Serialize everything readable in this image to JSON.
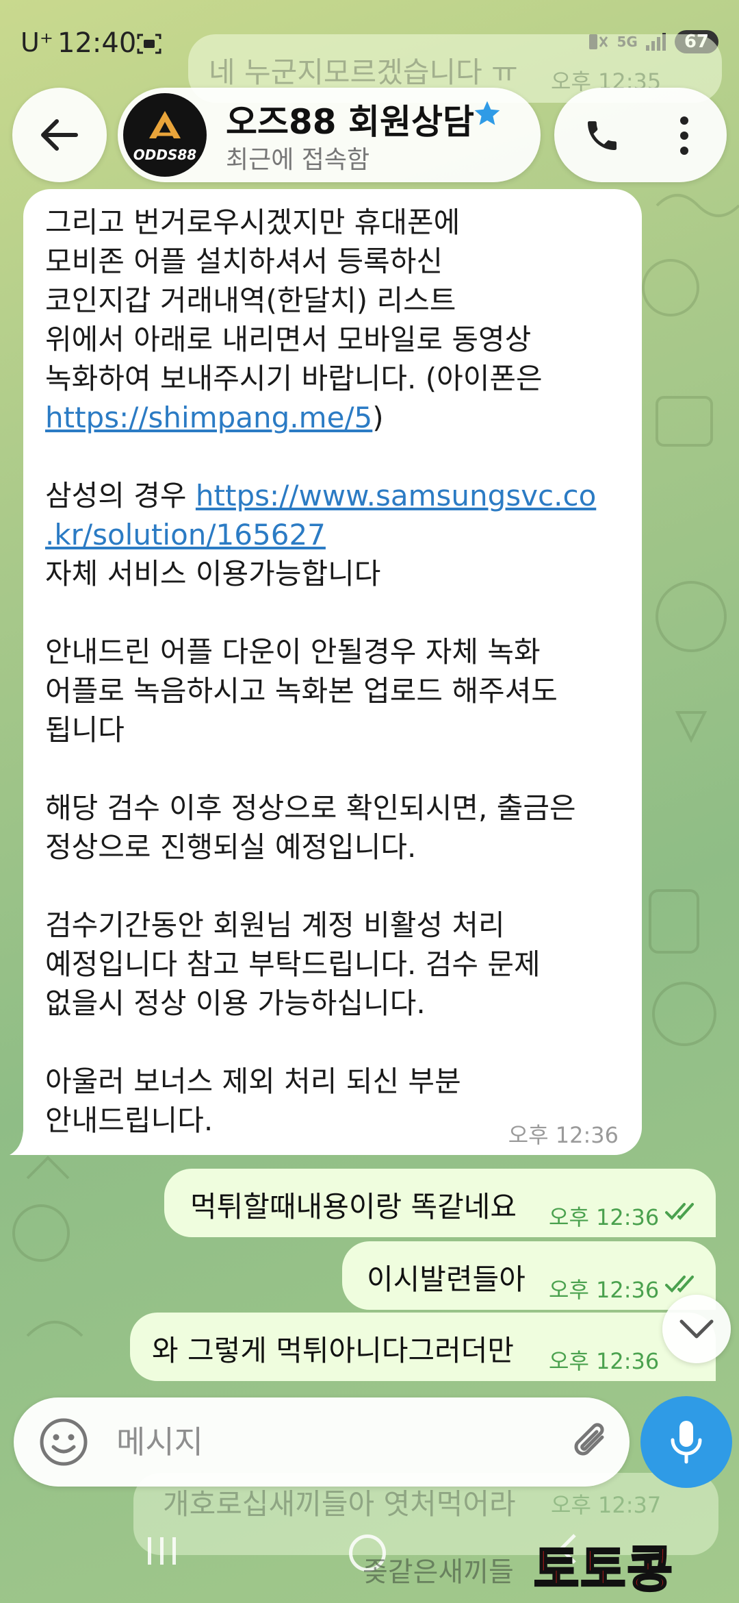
{
  "status_bar": {
    "carrier": "U⁺",
    "time": "12:40",
    "network": "5G",
    "battery": "67"
  },
  "previous_message": {
    "text": "네 누군지모르겠습니다 ㅠ",
    "time": "오후 12:35"
  },
  "header": {
    "avatar_text": "ODDS88",
    "title": "오즈88 회원상담",
    "subtitle": "최근에 접속함"
  },
  "incoming": {
    "lines": [
      "그리고 번거로우시겠지만 휴대폰에",
      "모비존 어플 설치하셔서 등록하신",
      "코인지갑 거래내역(한달치) 리스트",
      "위에서 아래로 내리면서 모바일로 동영상",
      "녹화하여 보내주시기 바랍니다. (아이폰은"
    ],
    "link1": "https://shimpang.me/5",
    "link1_suffix": ")",
    "samsung_prefix": "삼성의 경우 ",
    "link2_part1": "https://www.samsungsvc.co",
    "link2_part2": ".kr/solution/165627",
    "line_service": "자체 서비스 이용가능합니다",
    "para3": [
      "안내드린 어플 다운이 안될경우 자체 녹화",
      "어플로 녹음하시고 녹화본 업로드 해주셔도",
      "됩니다"
    ],
    "para4": [
      "해당 검수 이후 정상으로 확인되시면, 출금은",
      "정상으로 진행되실 예정입니다."
    ],
    "para5": [
      "검수기간동안 회원님 계정 비활성 처리",
      "예정입니다 참고 부탁드립니다. 검수 문제",
      "없을시 정상 이용 가능하십니다."
    ],
    "para6": [
      "아울러 보너스 제외 처리 되신 부분",
      "안내드립니다."
    ],
    "time": "오후 12:36"
  },
  "outgoing": [
    {
      "text": "먹튀할때내용이랑 똑같네요",
      "time": "오후 12:36"
    },
    {
      "text": "이시발련들아",
      "time": "오후 12:36"
    },
    {
      "text": "와 그렇게 먹튀아니다그러더만",
      "time": "오후 12:36"
    }
  ],
  "composer": {
    "placeholder": "메시지"
  },
  "behind_composer": {
    "text": "개호로십새끼들아 엿처먹어라",
    "time": "오후 12:37",
    "text2": "좆같은새끼들"
  },
  "watermark": "토토콩",
  "colors": {
    "outgoing_bubble": "#effdde",
    "accent_blue": "#2f9be6",
    "link": "#2b7bc4",
    "time_green": "#4aa14e",
    "watermark_red": "#e21b1b"
  }
}
